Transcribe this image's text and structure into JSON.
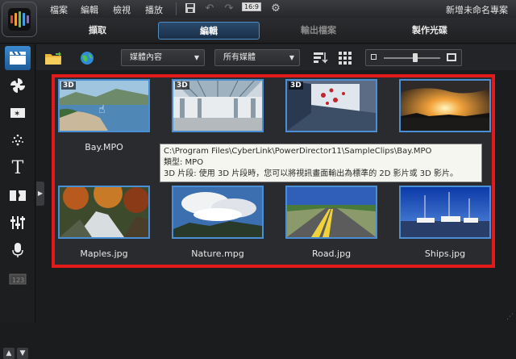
{
  "menu": {
    "items": [
      "檔案",
      "編輯",
      "檢視",
      "播放"
    ],
    "project_name": "新增未命名專案",
    "aspect_ratio": "16:9"
  },
  "tabs": [
    {
      "label": "擷取",
      "state": "normal"
    },
    {
      "label": "編輯",
      "state": "active"
    },
    {
      "label": "輸出檔案",
      "state": "dim"
    },
    {
      "label": "製作光碟",
      "state": "normal"
    }
  ],
  "toolbar": {
    "filter_content": "媒體內容",
    "filter_type": "所有媒體"
  },
  "library": {
    "items": [
      {
        "label": "Bay.MPO",
        "badge": "3D",
        "name": "bay"
      },
      {
        "label": "",
        "badge": "3D",
        "name": "mall"
      },
      {
        "label": "",
        "badge": "3D",
        "name": "interior"
      },
      {
        "label": "",
        "badge": "",
        "name": "sunset"
      },
      {
        "label": "Maples.jpg",
        "badge": "",
        "name": "maples"
      },
      {
        "label": "Nature.mpg",
        "badge": "",
        "name": "nature"
      },
      {
        "label": "Road.jpg",
        "badge": "",
        "name": "road"
      },
      {
        "label": "Ships.jpg",
        "badge": "",
        "name": "ships"
      }
    ]
  },
  "tooltip": {
    "path": "C:\\Program Files\\CyberLink\\PowerDirector11\\SampleClips\\Bay.MPO",
    "type": "類型: MPO",
    "desc": "3D 片段: 使用 3D 片段時，您可以將視訊畫面輸出為標準的 2D 影片或 3D 影片。"
  },
  "colors": {
    "selection_border": "#e41a1a",
    "thumb_border": "#4a8fd4",
    "active_tab": "#4d8ec7"
  }
}
